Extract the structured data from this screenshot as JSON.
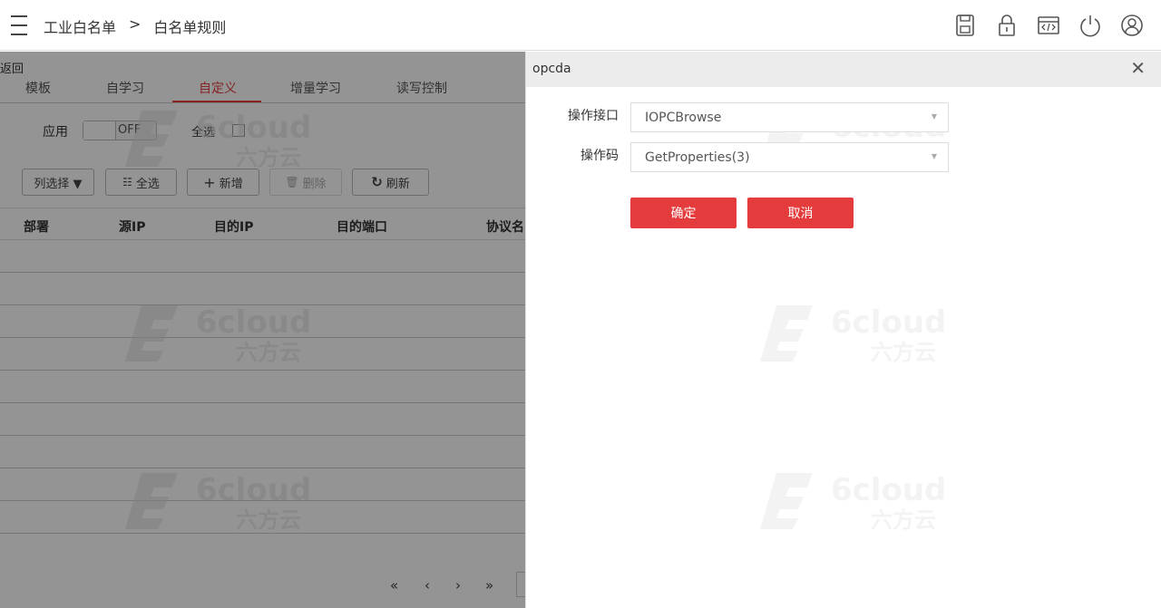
{
  "header": {
    "breadcrumb": [
      "工业白名单",
      ">",
      "白名单规则"
    ],
    "icons": [
      "save-icon",
      "lock-icon",
      "code-icon",
      "power-icon",
      "user-icon"
    ]
  },
  "left_panel": {
    "back_label": "返回",
    "tabs": [
      "模板",
      "自学习",
      "自定义",
      "增量学习",
      "读写控制"
    ],
    "active_tab": "自定义",
    "apply_label": "应用",
    "toggle_state": "OFF",
    "select_all_label": "全选",
    "toolbar": {
      "column_select": "列选择 ▼",
      "select_all": "全选",
      "add": "新增",
      "delete": "删除",
      "refresh": "刷新"
    },
    "table_headers": [
      "部署",
      "源IP",
      "目的IP",
      "目的端口",
      "协议名"
    ],
    "pager": [
      "«",
      "‹",
      "›",
      "»"
    ]
  },
  "watermark": {
    "brand": "6cloud",
    "brand_cn": "六方云"
  },
  "drawer": {
    "title": "opcda",
    "close": "✕",
    "fields": [
      {
        "label": "操作接口",
        "value": "IOPCBrowse"
      },
      {
        "label": "操作码",
        "value": "GetProperties(3)"
      }
    ],
    "confirm_label": "确定",
    "cancel_label": "取消"
  },
  "colors": {
    "accent": "#e43c3c",
    "overlay": "rgba(0,0,0,0.42)"
  }
}
